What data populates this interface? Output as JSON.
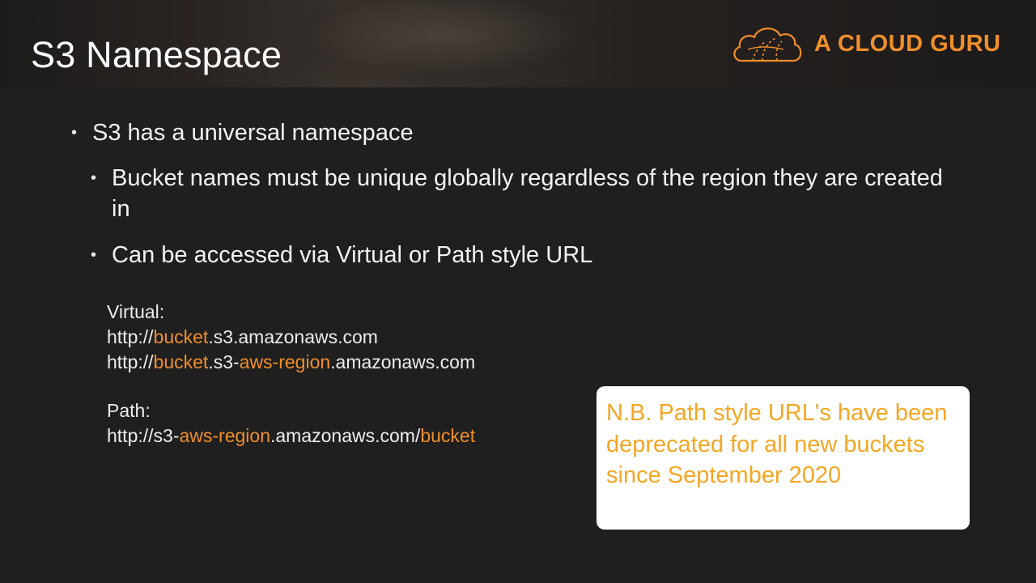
{
  "slide": {
    "title": "S3 Namespace"
  },
  "logo": {
    "text": "A CLOUD GURU",
    "icon": "cloud-icon",
    "color": "#f08f2a"
  },
  "bullets": [
    {
      "text": "S3 has a universal namespace",
      "level": 1
    },
    {
      "text": "Bucket names must be unique globally regardless of the region they are created in",
      "level": 2
    },
    {
      "text": "Can be accessed via Virtual or Path style URL",
      "level": 2
    }
  ],
  "urls": {
    "virtual_label": "Virtual:",
    "virtual_1": {
      "p1": "http://",
      "p2": "bucket",
      "p3": ".s3.amazonaws.com"
    },
    "virtual_2": {
      "p1": "http://",
      "p2": "bucket",
      "p3": ".s3-",
      "p4": "aws-region",
      "p5": ".amazonaws.com"
    },
    "path_label": "Path:",
    "path_1": {
      "p1": "http://s3-",
      "p2": "aws-region",
      "p3": ".amazonaws.com/",
      "p4": "bucket"
    }
  },
  "note": {
    "text": "N.B. Path style URL's have been deprecated for all new buckets since September 2020"
  },
  "colors": {
    "accent": "#f08f2a",
    "note_text": "#f5a623",
    "background": "#1f1f1f"
  }
}
